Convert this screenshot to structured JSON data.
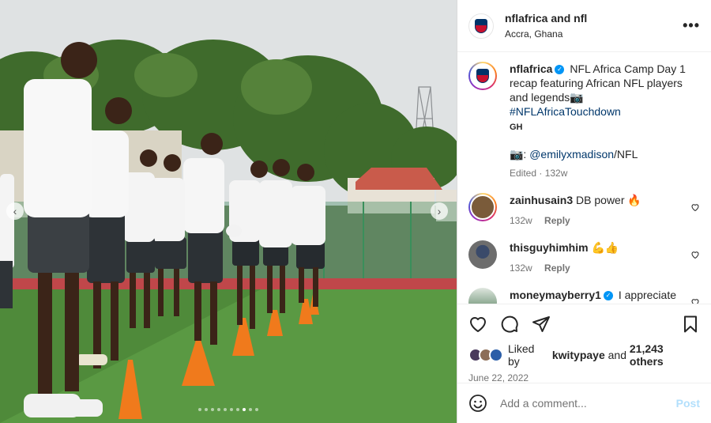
{
  "header": {
    "account": "nflafrica",
    "joiner": "and",
    "collaborator": "nfl",
    "location": "Accra, Ghana",
    "more_icon": "more-horizontal-icon"
  },
  "caption": {
    "username": "nflafrica",
    "text": "NFL Africa Camp Day 1 recap featuring African NFL players and legends",
    "emoji": "📷",
    "hashtag": "#NFLAfricaTouchdown",
    "region": "GH",
    "credit_emoji": "📷:",
    "credit_handle": "@emilyxmadison",
    "credit_suffix": "/NFL",
    "edited": "Edited · 132w"
  },
  "comments": [
    {
      "username": "zainhusain3",
      "text": "DB power 🔥",
      "age": "132w",
      "reply": "Reply"
    },
    {
      "username": "thisguyhimhim",
      "text": "💪👍",
      "age": "132w",
      "reply": "Reply"
    },
    {
      "username": "moneymayberry1",
      "text": "I appreciate",
      "age": "",
      "reply": ""
    }
  ],
  "likes": {
    "prefix": "Liked by",
    "user": "kwitypaye",
    "joiner": "and",
    "others": "21,243 others"
  },
  "date": "June 22, 2022",
  "add_comment": {
    "placeholder": "Add a comment...",
    "post_label": "Post"
  },
  "media": {
    "slide_count": 10,
    "active_slide": 8
  },
  "colors": {
    "accent": "#0095f6",
    "link": "#00376b",
    "post_disabled": "#b2dffc",
    "nfl_red": "#c8102e",
    "nfl_blue": "#013369"
  }
}
